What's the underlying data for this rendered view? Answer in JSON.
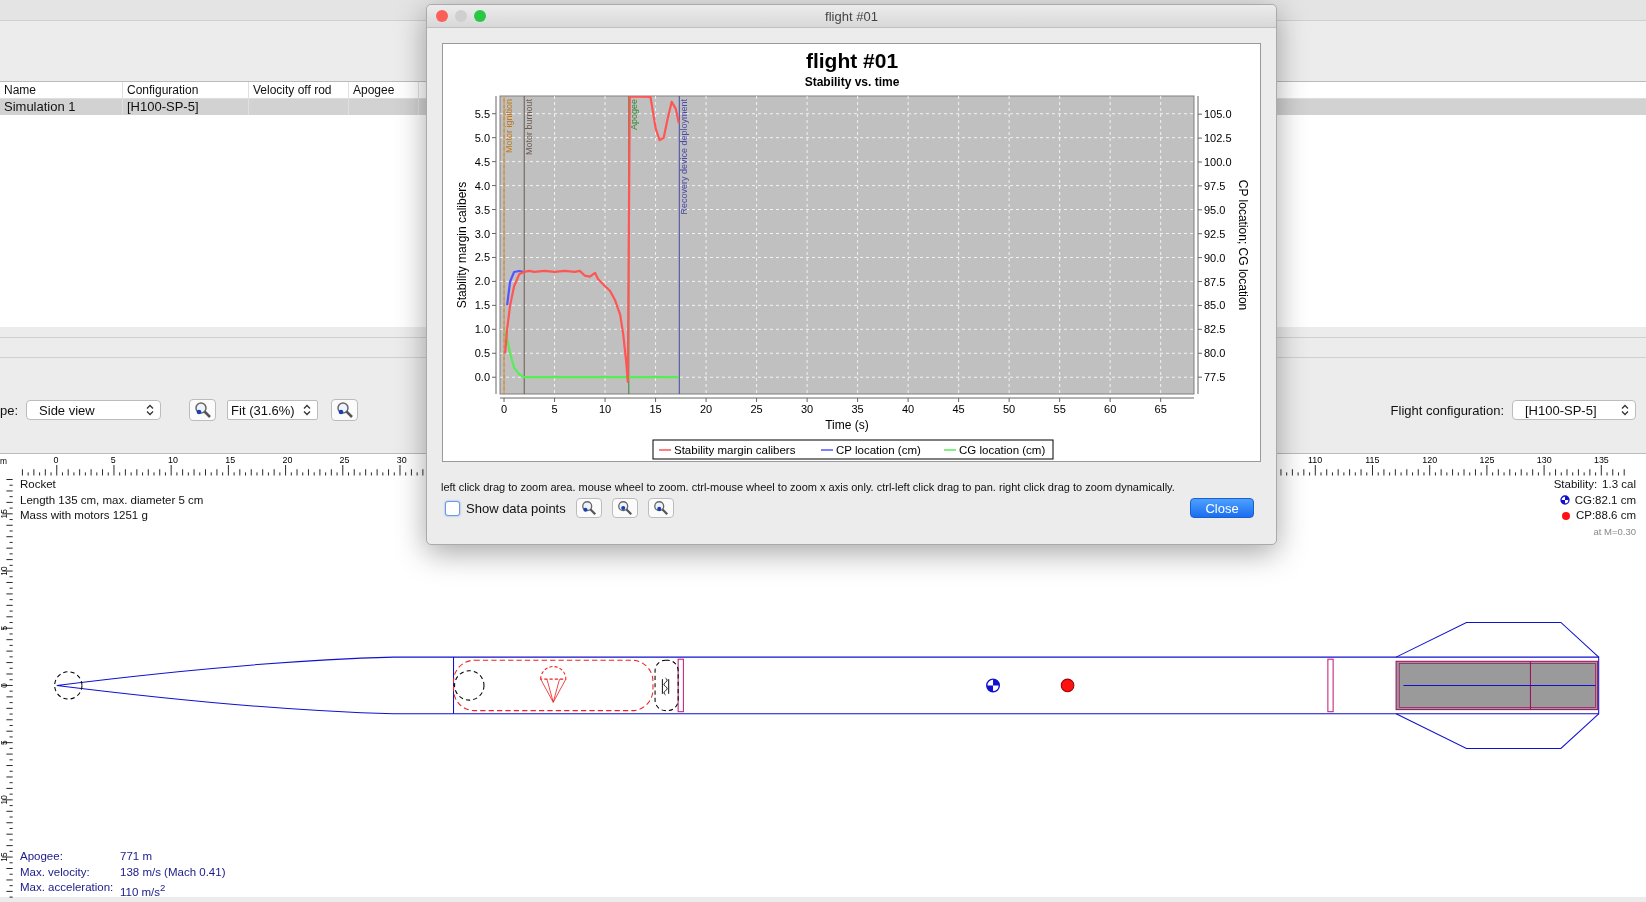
{
  "simulations_table": {
    "columns": [
      "Name",
      "Configuration",
      "Velocity off rod",
      "Apogee"
    ],
    "rows": [
      {
        "cells": [
          "Simulation 1",
          "[H100-SP-5]"
        ],
        "selected": true
      }
    ]
  },
  "view_toolbar": {
    "type_label": "pe:",
    "view_select": "Side view",
    "zoom_value": "Fit (31.6%)",
    "flight_config_label": "Flight configuration:",
    "flight_config_select": "[H100-SP-5]"
  },
  "rocket_view": {
    "ruler_unit": "m",
    "top_ruler_left_labels": [
      "0",
      "5",
      "10",
      "15",
      "20",
      "25",
      "30"
    ],
    "top_ruler_right_labels": [
      "110",
      "115",
      "120",
      "125",
      "130",
      "135"
    ],
    "left_ruler_labels": [
      "15",
      "10",
      "5",
      "0",
      "5",
      "10",
      "15"
    ],
    "rocket_info": [
      "Rocket",
      "Length 135 cm, max. diameter 5 cm",
      "Mass with motors 1251 g"
    ],
    "stability": {
      "label": "Stability:",
      "value": "1.3 cal",
      "cg": "CG:82.1 cm",
      "cp": "CP:88.6 cm",
      "mach": "at M=0.30"
    },
    "flight_summary": [
      {
        "label": "Apogee:",
        "value": "771 m"
      },
      {
        "label": "Max. velocity:",
        "value": "138 m/s  (Mach 0.41)"
      },
      {
        "label": "Max. acceleration:",
        "value": "110 m/s$^{2}$"
      }
    ]
  },
  "dialog": {
    "title": "flight #01",
    "chart_data": {
      "type": "line",
      "title": "flight #01",
      "subtitle": "Stability vs. time",
      "xlabel": "Time (s)",
      "ylabel": "Stability margin calibers",
      "y2label": "CP location; CG location",
      "xlim": [
        -0.4,
        68.3
      ],
      "ylim": [
        -0.35,
        5.87
      ],
      "y2lim": [
        75.74,
        106.9
      ],
      "xticks": [
        0,
        5,
        10,
        15,
        20,
        25,
        30,
        35,
        40,
        45,
        50,
        55,
        60,
        65
      ],
      "yticks": [
        {
          "value": 0,
          "label": "0.0"
        },
        {
          "value": 0.5,
          "label": "0.5"
        },
        {
          "value": 1,
          "label": "1.0"
        },
        {
          "value": 1.5,
          "label": "1.5"
        },
        {
          "value": 2,
          "label": "2.0"
        },
        {
          "value": 2.5,
          "label": "2.5"
        },
        {
          "value": 3,
          "label": "3.0"
        },
        {
          "value": 3.5,
          "label": "3.5"
        },
        {
          "value": 4,
          "label": "4.0"
        },
        {
          "value": 4.5,
          "label": "4.5"
        },
        {
          "value": 5,
          "label": "5.0"
        },
        {
          "value": 5.5,
          "label": "5.5"
        }
      ],
      "y2ticks": [
        {
          "value": 77.5,
          "label": "77.5"
        },
        {
          "value": 80,
          "label": "80.0"
        },
        {
          "value": 82.5,
          "label": "82.5"
        },
        {
          "value": 85,
          "label": "85.0"
        },
        {
          "value": 87.5,
          "label": "87.5"
        },
        {
          "value": 90,
          "label": "90.0"
        },
        {
          "value": 92.5,
          "label": "92.5"
        },
        {
          "value": 95,
          "label": "95.0"
        },
        {
          "value": 97.5,
          "label": "97.5"
        },
        {
          "value": 100,
          "label": "100.0"
        },
        {
          "value": 102.5,
          "label": "102.5"
        },
        {
          "value": 105,
          "label": "105.0"
        }
      ],
      "x": [
        0.1,
        0.3,
        0.6,
        1.0,
        1.5,
        2,
        2.5,
        3,
        4,
        5,
        6,
        7,
        7.5,
        8,
        8.5,
        9,
        9.3,
        10,
        10.5,
        11,
        11.5,
        11.8,
        12.1,
        12.25,
        12.35,
        12.45,
        14.5,
        15,
        15.4,
        15.8,
        16.2,
        16.6,
        17,
        17.3
      ],
      "series": [
        {
          "name": "Stability margin calibers",
          "color": "#ff5555",
          "values": [
            0.5,
            1.0,
            1.5,
            1.9,
            2.15,
            2.2,
            2.22,
            2.2,
            2.22,
            2.2,
            2.22,
            2.2,
            2.22,
            2.12,
            2.1,
            2.18,
            2.05,
            1.9,
            1.8,
            1.6,
            1.3,
            0.9,
            0.3,
            -0.1,
            3.0,
            5.86,
            5.85,
            5.2,
            4.95,
            5.0,
            5.4,
            5.75,
            5.6,
            5.3
          ]
        },
        {
          "name": "CP location (cm)",
          "color": "#5555ff",
          "axis": "y2",
          "values": [
            null,
            85.0,
            87.5,
            88.5,
            88.6,
            88.5,
            null,
            null,
            null,
            null,
            null,
            null,
            null,
            null,
            null,
            null,
            null,
            null,
            null,
            null,
            null,
            null,
            null,
            null,
            null,
            null,
            null,
            null,
            null,
            null,
            null,
            null,
            null,
            null
          ]
        },
        {
          "name": "CG location (cm)",
          "color": "#55ee55",
          "axis": "y2",
          "values": [
            82.3,
            81.5,
            80.0,
            78.5,
            77.8,
            77.5,
            77.5,
            77.5,
            77.5,
            77.5,
            77.5,
            77.5,
            77.5,
            77.5,
            77.5,
            77.5,
            77.5,
            77.5,
            77.5,
            77.5,
            77.5,
            77.5,
            77.5,
            77.5,
            77.5,
            77.5,
            77.5,
            77.5,
            77.5,
            77.5,
            77.5,
            77.5,
            77.5,
            77.5
          ]
        }
      ],
      "grid": true,
      "legend": "bottom",
      "ref_lines": [
        {
          "axis": "x",
          "value": 0,
          "label": "Motor ignition",
          "color": "#c07818"
        },
        {
          "axis": "x",
          "value": 2,
          "label": "Motor burnout",
          "color": "#6a5a50"
        },
        {
          "axis": "x",
          "value": 12.35,
          "label": "Apogee",
          "color": "#308a30"
        },
        {
          "axis": "x",
          "value": 17.35,
          "label": "Recovery device deployment",
          "color": "#4848a8"
        }
      ]
    },
    "help_text": "left click drag to zoom area. mouse wheel to zoom. ctrl-mouse wheel to zoom x axis only. ctrl-left click drag to pan.  right click drag to zoom dynamically.",
    "show_data_points": {
      "label": "Show data points",
      "checked": false
    },
    "close_button": "Close"
  }
}
